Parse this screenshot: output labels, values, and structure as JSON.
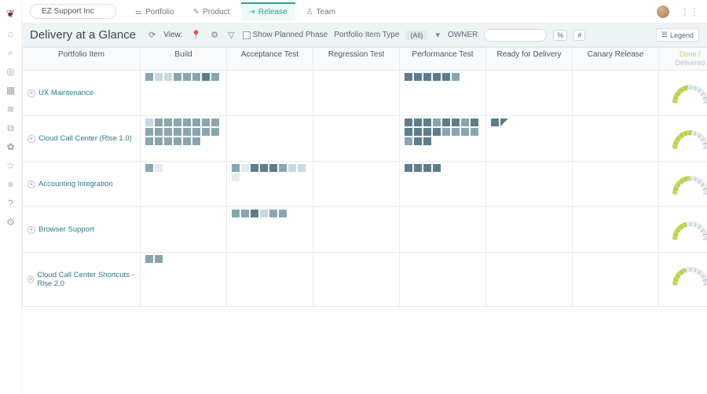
{
  "header": {
    "org": "EZ Support Inc",
    "tabs": [
      {
        "id": "portfolio",
        "label": "Portfolio",
        "icon": "⚍"
      },
      {
        "id": "product",
        "label": "Product",
        "icon": "✎"
      },
      {
        "id": "release",
        "label": "Release",
        "icon": "⇥",
        "active": true
      },
      {
        "id": "team",
        "label": "Team",
        "icon": "♙"
      }
    ]
  },
  "filter": {
    "title": "Delivery at a Glance",
    "view_label": "View:",
    "show_planned": "Show Planned Phase",
    "pi_type_label": "Portfolio Item Type",
    "pi_type_value": "(All)",
    "owner_label": "OWNER",
    "btn_pct": "%",
    "btn_num": "#",
    "legend": "Legend"
  },
  "columns": [
    "Portfolio Item",
    "Build",
    "Acceptance Test",
    "Regression Test",
    "Performance Test",
    "Ready for Delivery",
    "Canary Release"
  ],
  "gauge_header": {
    "done": "Done",
    "sep": "/",
    "delivered": "Delivered"
  },
  "rows": [
    {
      "name": "UX Maintenance",
      "cells": {
        "Build": {
          "blocks": [
            "md",
            "lt",
            "lt",
            "md",
            "md",
            "md",
            "dk",
            "md"
          ]
        },
        "Performance Test": {
          "blocks": [
            "dk",
            "dk",
            "dk",
            "dk",
            "dk",
            "md"
          ]
        }
      },
      "gauge": 0.45
    },
    {
      "name": "Cloud Call Center (Rlse 1.0)",
      "cells": {
        "Build": {
          "blocks": [
            "lt",
            "md",
            "md",
            "md",
            "md",
            "md",
            "md",
            "md",
            "md",
            "md",
            "md",
            "md",
            "md",
            "md",
            "md",
            "md",
            "md",
            "md",
            "md",
            "md",
            "md",
            "md"
          ]
        },
        "Performance Test": {
          "blocks": [
            "dk",
            "dk",
            "dk",
            "md",
            "dk",
            "dk",
            "md",
            "dk",
            "dk",
            "dk",
            "dk",
            "dk",
            "md",
            "md",
            "md",
            "md",
            "md",
            "dk",
            "dk"
          ]
        },
        "Ready for Delivery": {
          "blocks": [
            "dk",
            "flag"
          ]
        }
      },
      "gauge": 0.52
    },
    {
      "name": "Accounting Integration",
      "cells": {
        "Build": {
          "blocks": [
            "md",
            "vlt"
          ]
        },
        "Acceptance Test": {
          "blocks": [
            "md",
            "vlt",
            "dk",
            "dk",
            "dk",
            "md",
            "lt",
            "lt",
            "vlt"
          ]
        },
        "Performance Test": {
          "blocks": [
            "dk",
            "dk",
            "dk",
            "dk"
          ]
        }
      },
      "gauge": 0.48
    },
    {
      "name": "Browser Support",
      "cells": {
        "Acceptance Test": {
          "blocks": [
            "md",
            "md",
            "dk",
            "lt",
            "md",
            "md"
          ]
        }
      },
      "gauge": 0.42
    },
    {
      "name": "Cloud Call Center Shortcuts - Rlse 2.0",
      "cells": {
        "Build": {
          "blocks": [
            "md",
            "md"
          ]
        }
      },
      "gauge": 0.4
    }
  ],
  "rail_icons": [
    "home",
    "search",
    "target",
    "grid",
    "layers",
    "link",
    "globe",
    "star",
    "bars",
    "help",
    "settings"
  ]
}
